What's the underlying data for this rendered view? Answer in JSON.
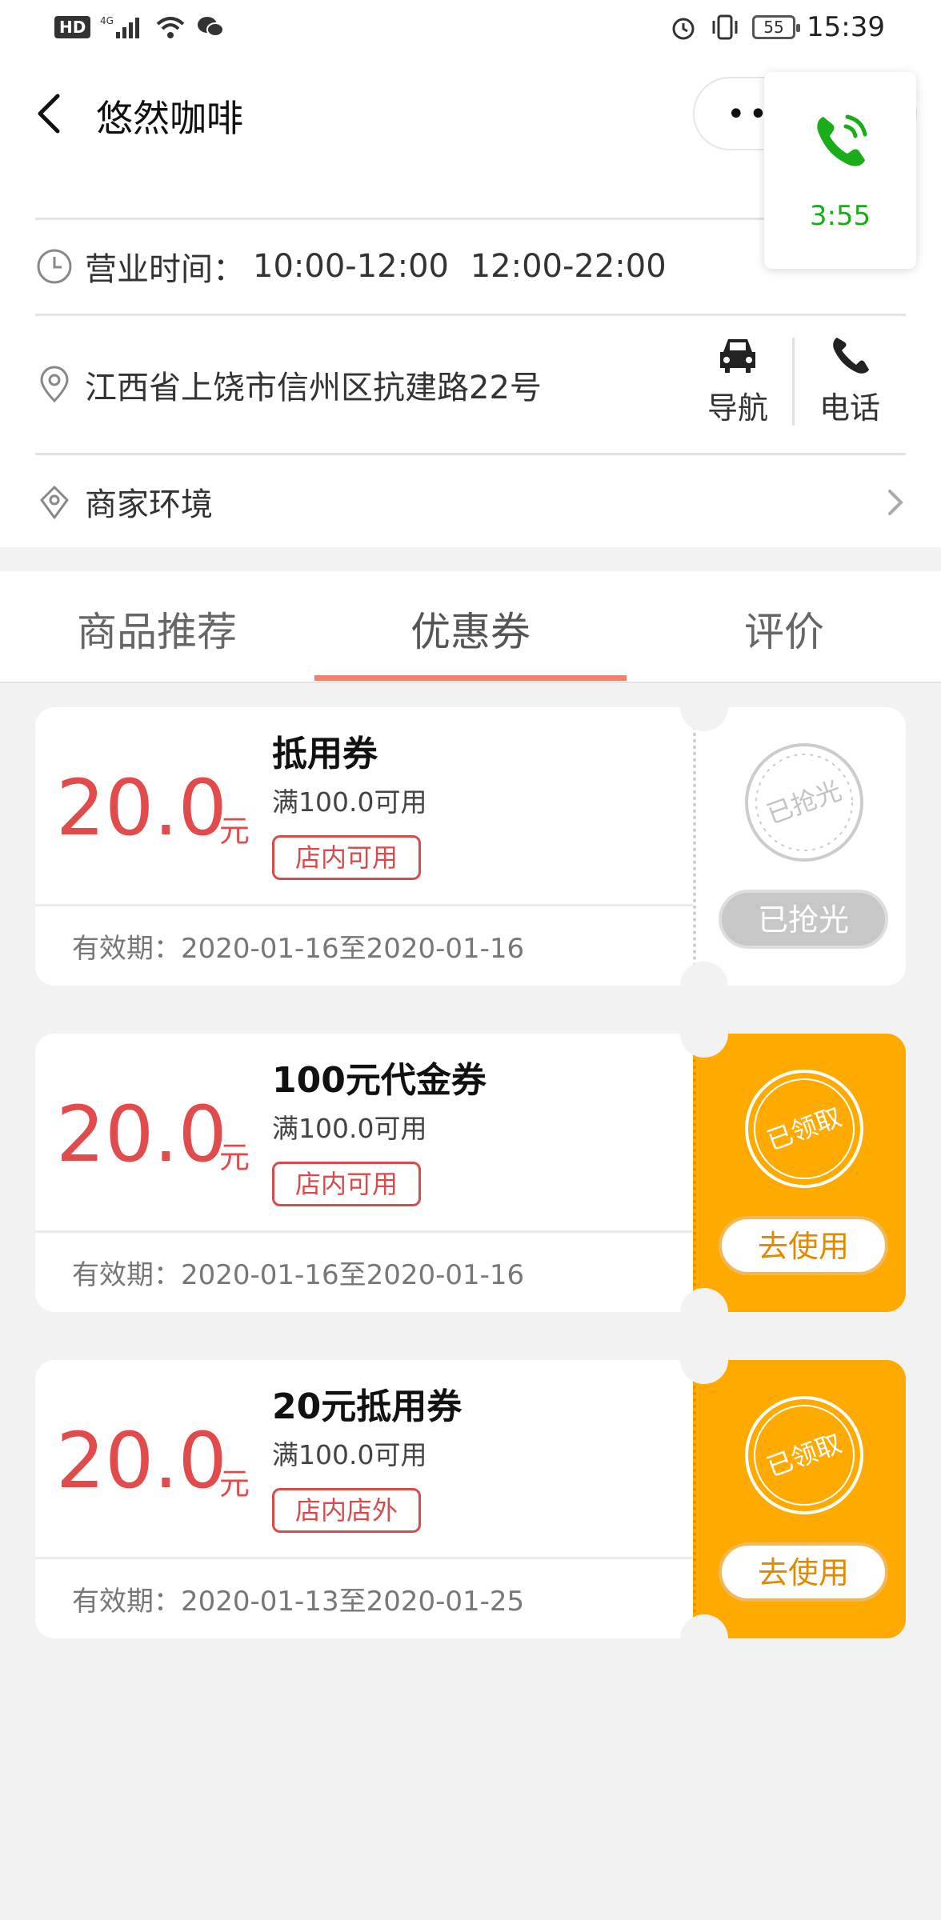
{
  "status_bar": {
    "network_badge": "HD",
    "network_type": "4G",
    "battery": "55",
    "time": "15:39"
  },
  "header": {
    "title": "悠然咖啡",
    "capsule_dots": "••"
  },
  "call_float": {
    "duration": "3:55"
  },
  "info": {
    "hours_label": "营业时间：",
    "hours_value": "10:00-12:00   12:00-22:00",
    "address": "江西省上饶市信州区抗建路22号",
    "nav_label": "导航",
    "phone_label": "电话",
    "environment_label": "商家环境"
  },
  "tabs": [
    {
      "label": "商品推荐"
    },
    {
      "label": "优惠券"
    },
    {
      "label": "评价"
    }
  ],
  "coupons": [
    {
      "amount": "20.0",
      "unit": "元",
      "name": "抵用券",
      "condition": "满100.0可用",
      "tag": "店内可用",
      "validity": "有效期：2020-01-16至2020-01-16",
      "stamp": "已抢光",
      "button": "已抢光",
      "state": "sold-out"
    },
    {
      "amount": "20.0",
      "unit": "元",
      "name": "100元代金券",
      "condition": "满100.0可用",
      "tag": "店内可用",
      "validity": "有效期：2020-01-16至2020-01-16",
      "stamp": "已领取",
      "button": "去使用",
      "state": "claimed"
    },
    {
      "amount": "20.0",
      "unit": "元",
      "name": "20元抵用券",
      "condition": "满100.0可用",
      "tag": "店内店外",
      "validity": "有效期：2020-01-13至2020-01-25",
      "stamp": "已领取",
      "button": "去使用",
      "state": "claimed"
    }
  ],
  "colors": {
    "accent_red": "#e24b4b",
    "tab_underline": "#f08070",
    "coupon_orange": "#ffaa00",
    "call_green": "#1aad19"
  }
}
